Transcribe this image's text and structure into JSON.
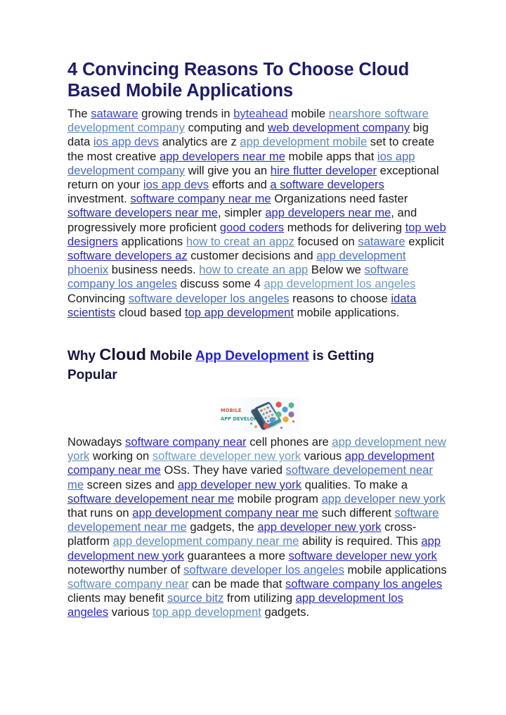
{
  "document": {
    "title": "4 Convincing Reasons To Choose Cloud Based Mobile Applications",
    "subheading": {
      "part1": "Why ",
      "big_word": "Cloud",
      "part2": " Mobile ",
      "link": "App Development",
      "part3": " is Getting Popular"
    }
  },
  "paragraph1": {
    "t1": "The ",
    "l1": "sataware",
    "t2": " growing trends in ",
    "l2": "byteahead",
    "t3": " mobile ",
    "l3": "nearshore software development company",
    "t4": " computing and ",
    "l4": "web development company",
    "t5": " big data ",
    "l5": "ios app devs",
    "t6": " analytics are z ",
    "l6": "app development mobile",
    "t7": " set to create the most creative ",
    "l7": "app developers near me",
    "t8": " mobile apps that ",
    "l8": "ios app development company",
    "t9": " will give you an ",
    "l9": "hire flutter developer",
    "t10": " exceptional return on your ",
    "l10": "ios app devs",
    "t11": " efforts and ",
    "l11": "a software developers",
    "t12": " investment. ",
    "l12": "software company near me",
    "t13": " Organizations need faster ",
    "l13": "software developers near me",
    "t14": ", simpler ",
    "l14": "app developers near me",
    "t15": ", and progressively more proficient ",
    "l15": "good coders",
    "t16": " methods for delivering ",
    "l16": "top web designers",
    "t17": " applications ",
    "l17": "how to creat an appz",
    "t18": " focused on ",
    "l18": "sataware",
    "t19": " explicit ",
    "l19": "software developers az",
    "t20": " customer decisions and ",
    "l20": "app development phoenix",
    "t21": " business needs. ",
    "l21": "how to create an app",
    "t22": " Below we ",
    "l22": "software company los angeles",
    "t23": " discuss some 4  ",
    "l23": "app development los angeles",
    "t24": " Convincing ",
    "l24": "software developer los angeles",
    "t25": " reasons to choose ",
    "l25": "idata scientists",
    "t26": " cloud based ",
    "l26": "top app development",
    "t27": " mobile applications."
  },
  "figure": {
    "alt": "mobile app development banner",
    "line1": "MOBILE",
    "line2": "APP DEVELOPMENT",
    "line1_color": "#d4533c",
    "line2_color": "#2f8f86"
  },
  "paragraph2": {
    "t1": "Nowadays ",
    "l1": "software company near",
    "t2": " cell phones are ",
    "l2": "app development new york",
    "t3": " working on ",
    "l3": "software developer new york",
    "t4": " various ",
    "l4": "app development company near me",
    "t5": " OSs. They have varied ",
    "l5": "software developement near me",
    "t6": " screen sizes and ",
    "l6": "app developer new york",
    "t7": " qualities. To make a ",
    "l7": "software developement near me",
    "t8": " mobile program ",
    "l8": "app developer new york",
    "t9": " that runs on ",
    "l9": "app development company near me",
    "t10": " such different ",
    "l10": "software developement near me",
    "t11": " gadgets, the ",
    "l11": "app developer new york",
    "t12": " cross-platform ",
    "l12": "app development company near me",
    "t13": " ability is required. This ",
    "l13": "app development new york",
    "t14": " guarantees a more ",
    "l14": "software developer new york",
    "t15": " noteworthy number of ",
    "l15": "software developer los angeles",
    "t16": " mobile applications ",
    "l16": "software company near",
    "t17": " can be made that ",
    "l17": "software company los angeles",
    "t18": " clients may benefit ",
    "l18": "source bitz",
    "t19": " from utilizing ",
    "l19": "app development los angeles",
    "t20": " various ",
    "l20": "top app development",
    "t21": " gadgets."
  },
  "colors": {
    "title": "#1c1c70",
    "subheading": "#16163f",
    "body_text": "#1b1b1b",
    "link_navy": "#2a2ac4",
    "link_blue": "#3b49c8",
    "link_mid": "#4a6fc0",
    "link_steel": "#5f8cb8",
    "link_light": "#6f9ec4",
    "background": "#ffffff"
  }
}
